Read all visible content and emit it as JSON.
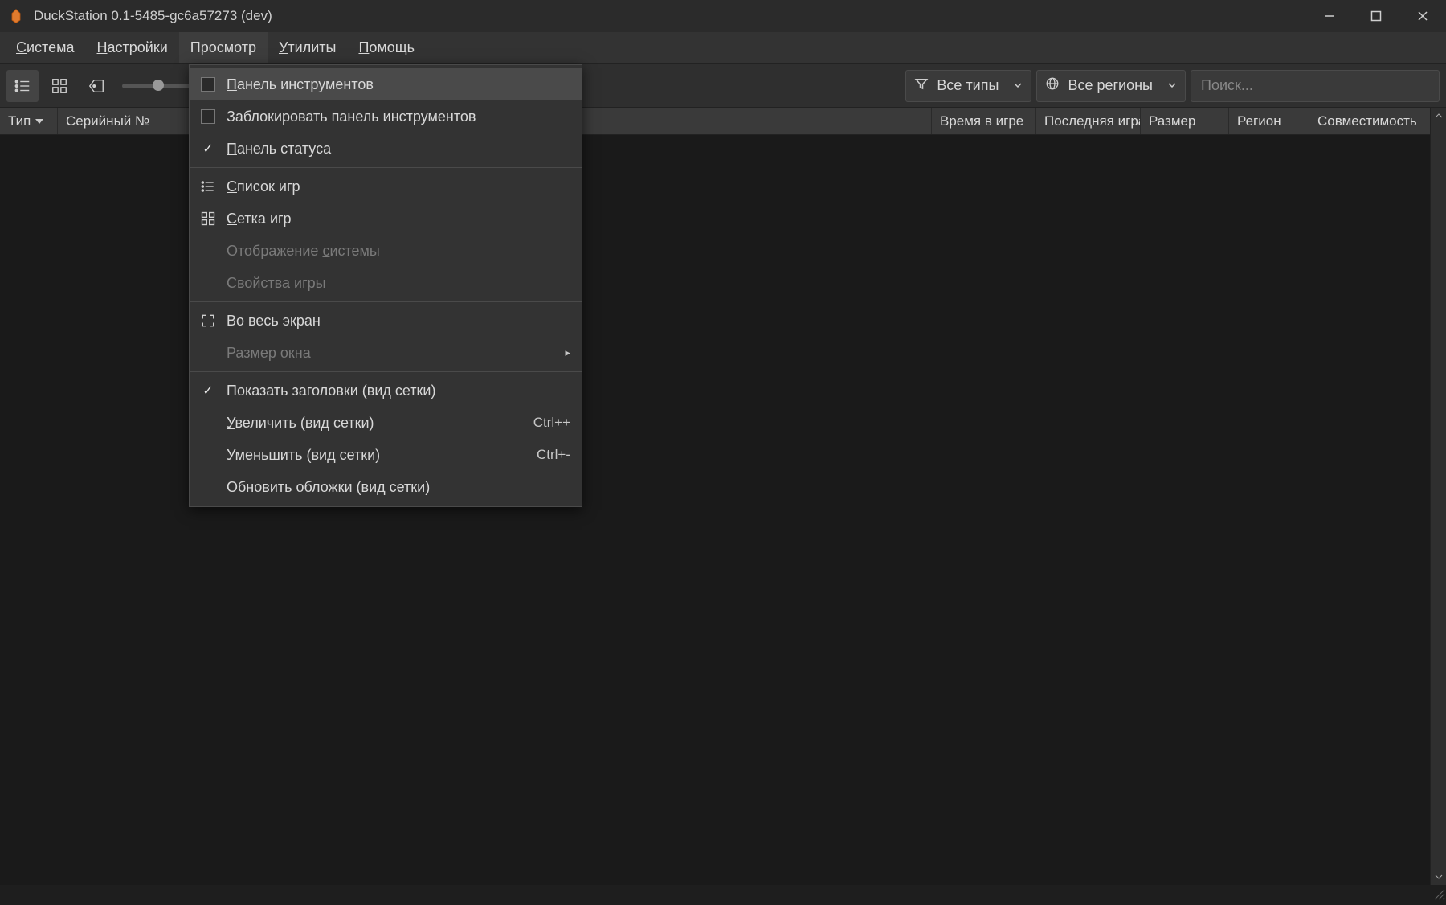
{
  "window": {
    "title": "DuckStation 0.1-5485-gc6a57273 (dev)"
  },
  "menubar": {
    "system": "Система",
    "settings": "Настройки",
    "view": "Просмотр",
    "utilities": "Утилиты",
    "help": "Помощь"
  },
  "toolbar": {
    "filter_type": "Все типы",
    "filter_region": "Все регионы",
    "search_placeholder": "Поиск..."
  },
  "columns": {
    "type": "Тип",
    "serial": "Серийный №",
    "playtime": "Время в игре",
    "lastplayed": "Последняя игра",
    "size": "Размер",
    "region": "Регион",
    "compat": "Совместимость"
  },
  "dropdown": {
    "toolbar_panel": "Панель инструментов",
    "lock_toolbar": "Заблокировать панель инструментов",
    "status_panel": "Панель статуса",
    "game_list": "Список игр",
    "game_grid": "Сетка игр",
    "system_display": "Отображение системы",
    "game_props": "Свойства игры",
    "fullscreen": "Во весь экран",
    "window_size": "Размер окна",
    "show_titles": "Показать заголовки (вид сетки)",
    "zoom_in": "Увеличить (вид сетки)",
    "zoom_in_sc": "Ctrl++",
    "zoom_out": "Уменьшить (вид сетки)",
    "zoom_out_sc": "Ctrl+-",
    "refresh_covers": "Обновить обложки (вид сетки)"
  }
}
